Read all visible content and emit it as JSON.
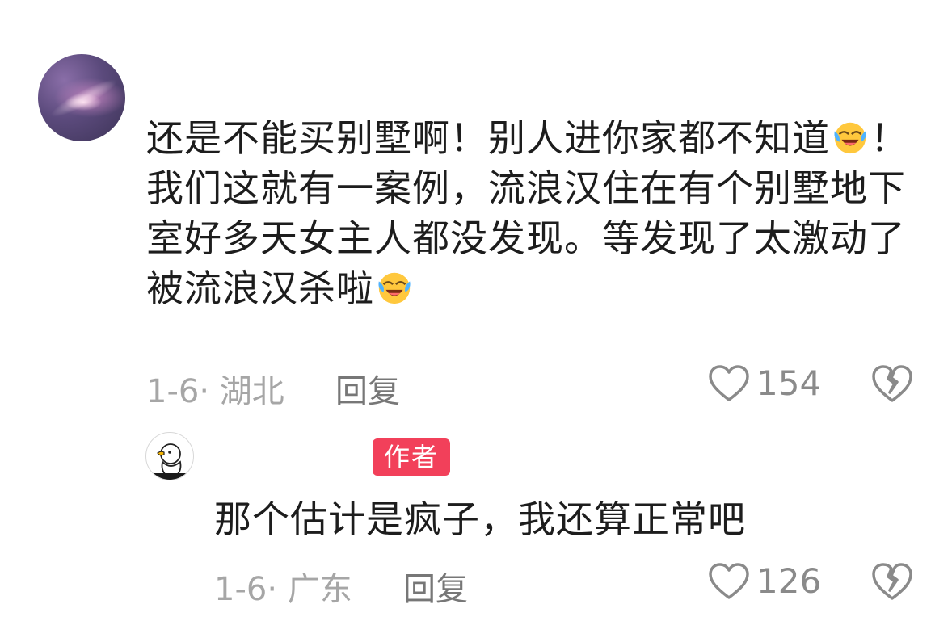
{
  "comment": {
    "text_part1": "还是不能买别墅啊！别人进你家都不知道",
    "text_part2": "！我们这就有一案例，流浪汉住在有个别墅地下室好多天女主人都没发现。等发现了太激动了被流浪汉杀啦",
    "emoji": "laughing-crying-emoji",
    "date_location": "1-6· 湖北",
    "reply_label": "回复",
    "like_count": "154"
  },
  "reply": {
    "badge": "作者",
    "text": "那个估计是疯子，我还算正常吧",
    "date_location": "1-6· 广东",
    "reply_label": "回复",
    "like_count": "126"
  },
  "colors": {
    "badge": "#f2405a",
    "meta": "#a6a6a6",
    "text": "#1d1d1d"
  }
}
